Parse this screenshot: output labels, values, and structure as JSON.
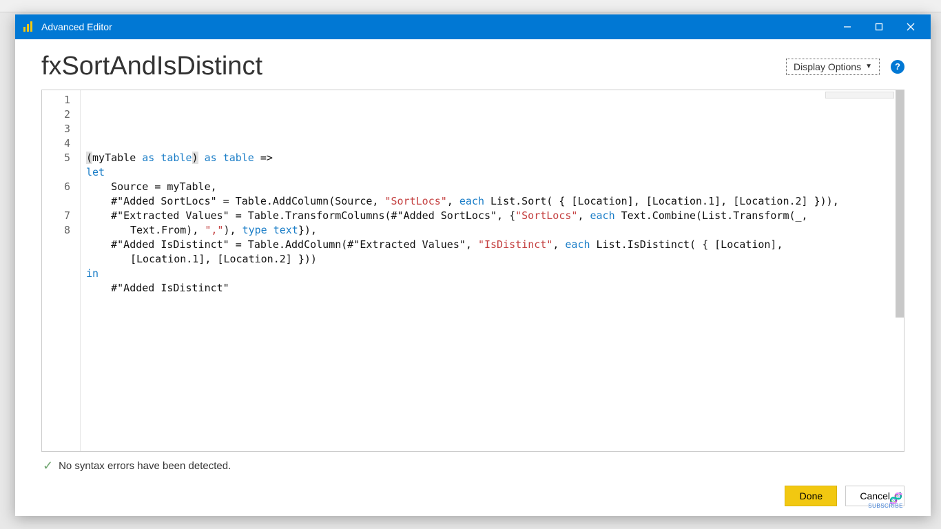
{
  "window": {
    "title": "Advanced Editor"
  },
  "header": {
    "query_name": "fxSortAndIsDistinct",
    "display_options_label": "Display Options",
    "help_text": "?"
  },
  "code": {
    "line_numbers": [
      "1",
      "2",
      "3",
      "4",
      "5",
      "6",
      "7",
      "8"
    ],
    "lines": [
      {
        "tokens": [
          {
            "t": "(",
            "c": "paren-hl"
          },
          {
            "t": "myTable "
          },
          {
            "t": "as",
            "c": "kw"
          },
          {
            "t": " "
          },
          {
            "t": "table",
            "c": "kw"
          },
          {
            "t": ")",
            "c": "paren-hl"
          },
          {
            "t": " "
          },
          {
            "t": "as",
            "c": "kw"
          },
          {
            "t": " "
          },
          {
            "t": "table",
            "c": "kw"
          },
          {
            "t": " =>"
          }
        ]
      },
      {
        "tokens": [
          {
            "t": "let",
            "c": "kw"
          }
        ]
      },
      {
        "tokens": [
          {
            "t": "    Source = myTable,"
          }
        ]
      },
      {
        "tokens": [
          {
            "t": "    #\"Added SortLocs\" = Table.AddColumn(Source, "
          },
          {
            "t": "\"SortLocs\"",
            "c": "str"
          },
          {
            "t": ", "
          },
          {
            "t": "each",
            "c": "kw"
          },
          {
            "t": " List.Sort( { [Location], [Location.1], [Location.2] })),"
          }
        ]
      },
      {
        "tokens": [
          {
            "t": "    #\"Extracted Values\" = Table.TransformColumns(#\"Added SortLocs\", {"
          },
          {
            "t": "\"SortLocs\"",
            "c": "str"
          },
          {
            "t": ", "
          },
          {
            "t": "each",
            "c": "kw"
          },
          {
            "t": " Text.Combine(List.Transform(_,"
          }
        ],
        "wrap": [
          {
            "t": "Text.From), "
          },
          {
            "t": "\",\"",
            "c": "str"
          },
          {
            "t": "), "
          },
          {
            "t": "type",
            "c": "typekw"
          },
          {
            "t": " "
          },
          {
            "t": "text",
            "c": "typekw"
          },
          {
            "t": "}),"
          }
        ]
      },
      {
        "tokens": [
          {
            "t": "    #\"Added IsDistinct\" = Table.AddColumn(#\"Extracted Values\", "
          },
          {
            "t": "\"IsDistinct\"",
            "c": "str"
          },
          {
            "t": ", "
          },
          {
            "t": "each",
            "c": "kw"
          },
          {
            "t": " List.IsDistinct( { [Location],"
          }
        ],
        "wrap": [
          {
            "t": "[Location.1], [Location.2] }))"
          }
        ]
      },
      {
        "tokens": [
          {
            "t": "in",
            "c": "kw"
          }
        ]
      },
      {
        "tokens": [
          {
            "t": "    #\"Added IsDistinct\""
          }
        ]
      }
    ]
  },
  "status": {
    "message": "No syntax errors have been detected."
  },
  "buttons": {
    "done": "Done",
    "cancel": "Cancel"
  },
  "overlay": {
    "subscribe": "SUBSCRIBE"
  }
}
